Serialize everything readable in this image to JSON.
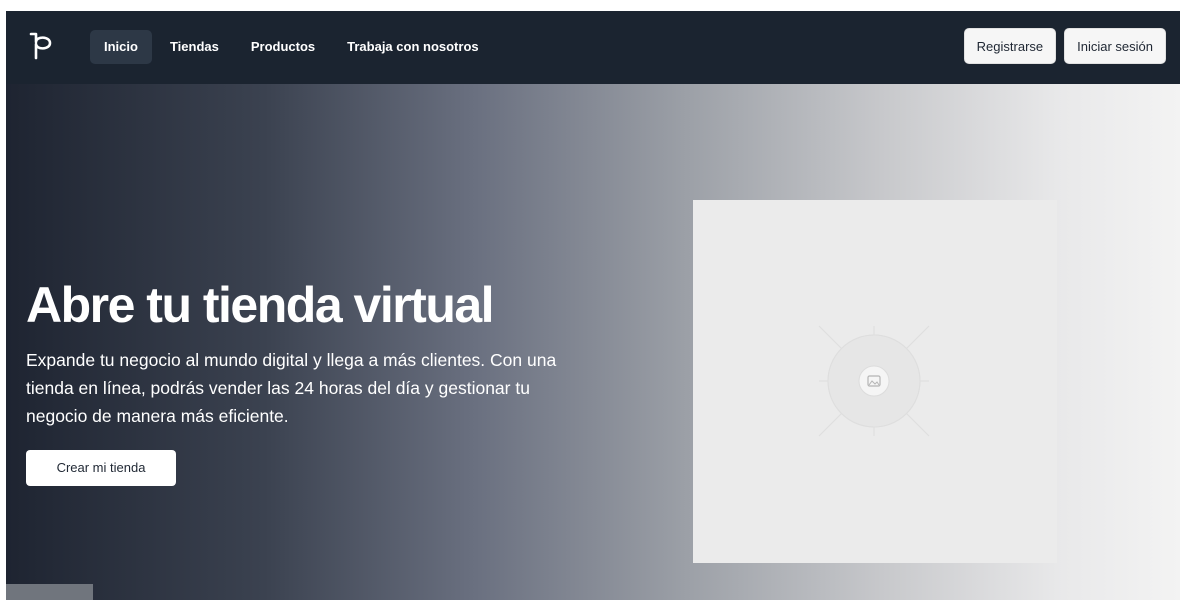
{
  "nav": {
    "logo_icon": "brand-logo-icon",
    "links": [
      {
        "label": "Inicio",
        "active": true
      },
      {
        "label": "Tiendas",
        "active": false
      },
      {
        "label": "Productos",
        "active": false
      },
      {
        "label": "Trabaja con nosotros",
        "active": false
      }
    ],
    "register_label": "Registrarse",
    "login_label": "Iniciar sesión"
  },
  "hero": {
    "title": "Abre tu tienda virtual",
    "description": "Expande tu negocio al mundo digital y llega a más clientes. Con una tienda en línea, podrás vender las 24 horas del día y gestionar tu negocio de manera más eficiente.",
    "cta_label": "Crear mi tienda",
    "image_icon": "image-placeholder-icon"
  },
  "colors": {
    "navbar_bg": "#1b2430",
    "active_tab_bg": "#2d3846",
    "hero_gradient_start": "#1e2431",
    "hero_gradient_end": "#f3f3f3",
    "placeholder_bg": "#ebebeb"
  }
}
